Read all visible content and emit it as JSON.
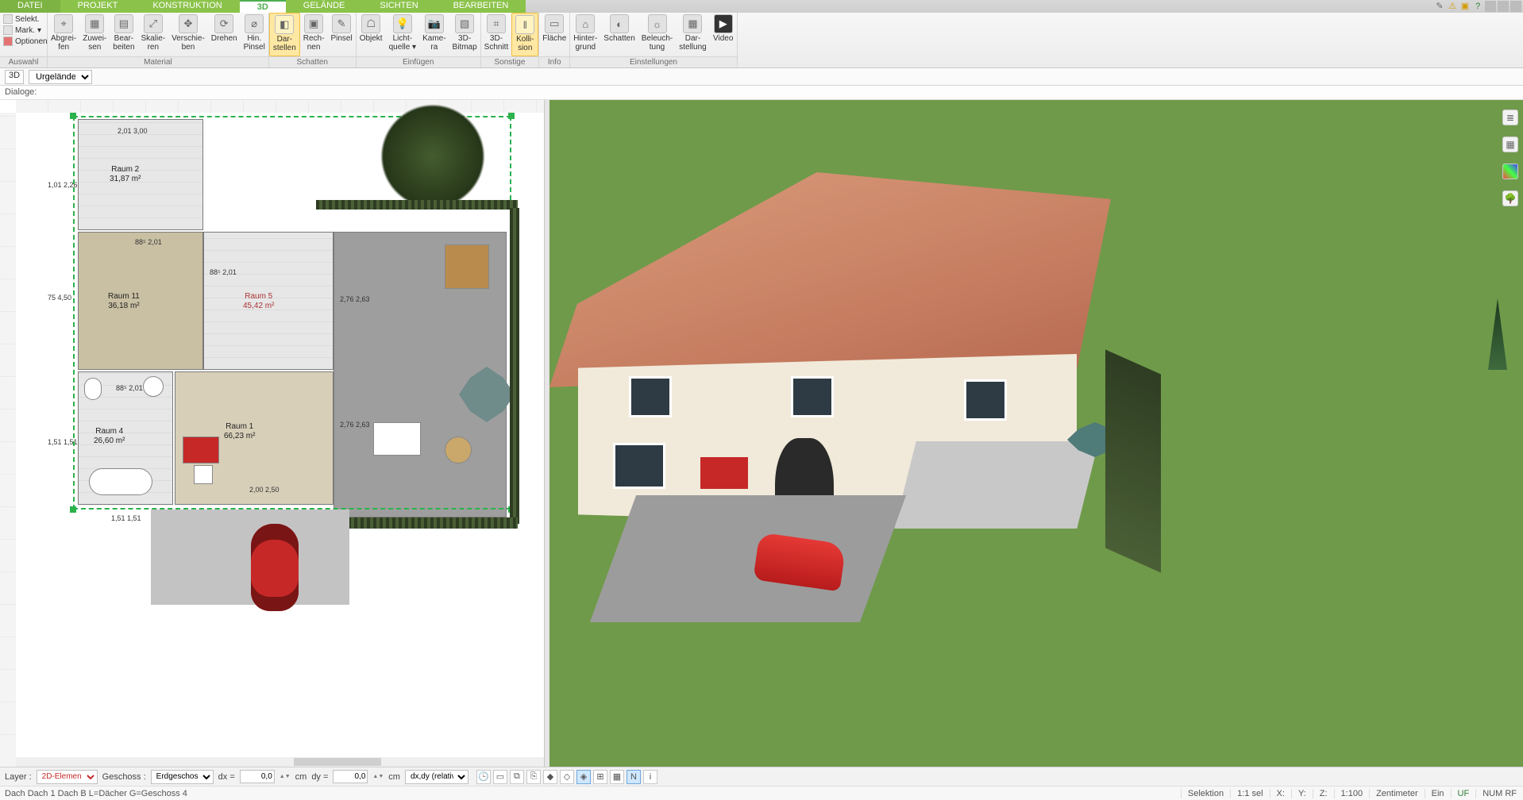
{
  "tabs": {
    "file": "DATEI",
    "projekt": "PROJEKT",
    "konstruktion": "KONSTRUKTION",
    "d3": "3D",
    "gelaende": "GELÄNDE",
    "sichten": "SICHTEN",
    "bearbeiten": "BEARBEITEN"
  },
  "ribbon": {
    "auswahl": {
      "label": "Auswahl",
      "selekt": "Selekt.",
      "mark": "Mark.",
      "optionen": "Optionen"
    },
    "material": {
      "label": "Material",
      "abgreifen": "Abgrei-\nfen",
      "zuweisen": "Zuwei-\nsen",
      "bearbeiten": "Bear-\nbeiten",
      "skalieren": "Skalie-\nren",
      "verschieben": "Verschie-\nben",
      "drehen": "Drehen",
      "hinpinsel": "Hin.\nPinsel"
    },
    "schatten": {
      "label": "Schatten",
      "darstellen": "Dar-\nstellen",
      "rechnen": "Rech-\nnen",
      "pinsel": "Pinsel"
    },
    "einfuegen": {
      "label": "Einfügen",
      "objekt": "Objekt",
      "lichtquelle": "Licht-\nquelle ▾",
      "kamera": "Kame-\nra",
      "bitmap": "3D-\nBitmap"
    },
    "sonstige": {
      "label": "Sonstige",
      "schnitt": "3D-\nSchnitt",
      "kollision": "Kolli-\nsion"
    },
    "info": {
      "label": "Info",
      "flaeche": "Fläche"
    },
    "einstellungen": {
      "label": "Einstellungen",
      "hintergrund": "Hinter-\ngrund",
      "schatten": "Schatten",
      "beleuchtung": "Beleuch-\ntung",
      "darstellung": "Dar-\nstellung",
      "video": "Video"
    }
  },
  "view_row": {
    "view": "3D",
    "layer_name": "Urgelände"
  },
  "dialog_row": {
    "label": "Dialoge:"
  },
  "plan": {
    "rooms": {
      "r2": {
        "name": "Raum 2",
        "area": "31,87 m²"
      },
      "r11": {
        "name": "Raum 11",
        "area": "36,18 m²"
      },
      "r5": {
        "name": "Raum 5",
        "area": "45,42 m²"
      },
      "r4": {
        "name": "Raum 4",
        "area": "26,60 m²"
      },
      "r1": {
        "name": "Raum 1",
        "area": "66,23 m²"
      }
    },
    "dims": {
      "d1": "1,01\n2,26",
      "d2": "75\n4,50",
      "d3": "1,51\n1,51",
      "d4": "2,01\n3,00",
      "d5": "88⁵\n2,01",
      "d6": "88⁵\n2,01",
      "d7": "88⁵\n2,01",
      "d8": "2,76\n2,63",
      "d9": "2,76\n2,63",
      "d10": "2,00\n2,50",
      "d11": "1,51\n1,51"
    }
  },
  "bottom": {
    "layer_label": "Layer :",
    "layer_value": "2D-Elemen",
    "geschoss_label": "Geschoss :",
    "geschoss_value": "Erdgeschos",
    "dx_label": "dx =",
    "dx_value": "0,0",
    "dy_label": "dy =",
    "dy_value": "0,0",
    "cm": "cm",
    "mode": "dx,dy (relativ ka"
  },
  "status": {
    "left": "Dach Dach 1 Dach B L=Dächer G=Geschoss 4",
    "selektion": "Selektion",
    "scale": "1:1 sel",
    "x": "X:",
    "y": "Y:",
    "z": "Z:",
    "scale2": "1:100",
    "unit": "Zentimeter",
    "ein": "Ein",
    "uf": "UF",
    "num": "NUM RF"
  }
}
